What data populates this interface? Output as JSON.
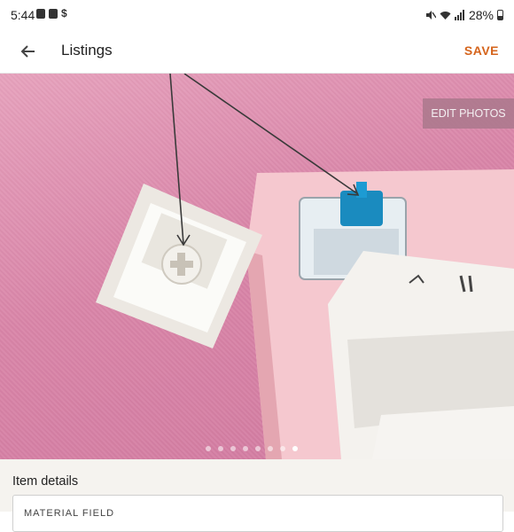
{
  "status_bar": {
    "time": "5:44",
    "battery": "28%",
    "left_icons": [
      "image-icon",
      "camera-icon",
      "dollar-icon"
    ],
    "right_icons": [
      "mute-icon",
      "wifi-icon",
      "signal-icon",
      "battery-icon"
    ]
  },
  "app_bar": {
    "title": "Listings",
    "save_label": "SAVE",
    "back_icon": "back-arrow-icon"
  },
  "photo": {
    "edit_label": "EDIT PHOTOS",
    "carousel": {
      "total": 8,
      "active_index": 7
    }
  },
  "item_details": {
    "heading": "Item details",
    "field_label": "MATERIAL FIELD"
  },
  "colors": {
    "accent": "#d5641c",
    "photo_pink": "#d985a8",
    "details_bg": "#f5f3ef"
  }
}
